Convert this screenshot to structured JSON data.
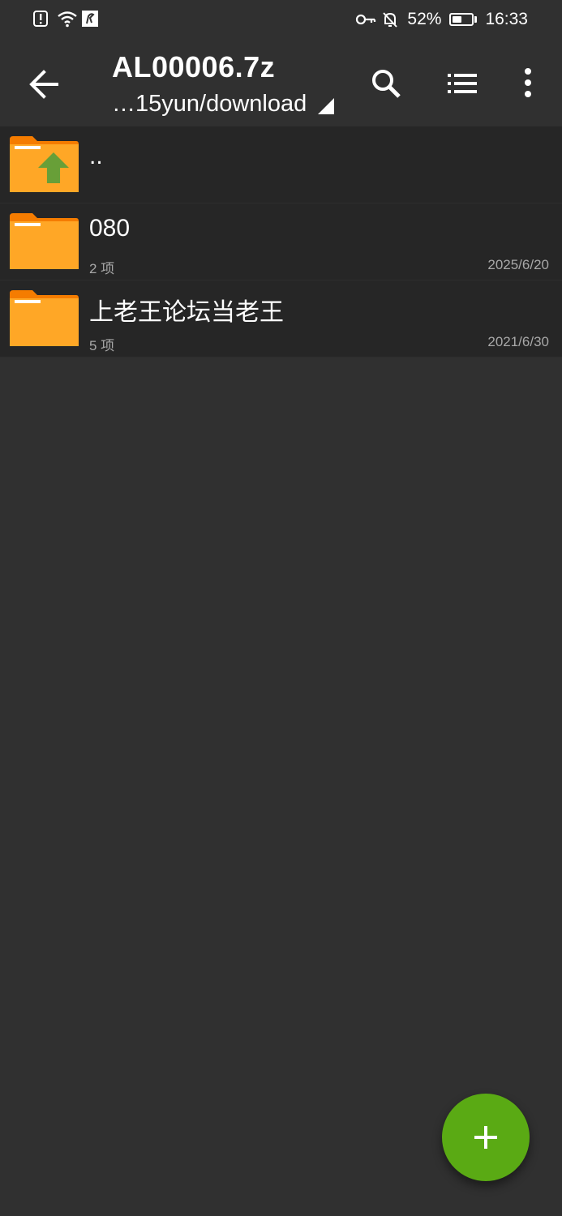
{
  "status_bar": {
    "battery_percent": "52%",
    "battery_level": 0.52,
    "time": "16:33",
    "icons": [
      "alert-sim-icon",
      "wifi-icon",
      "app-notification-icon",
      "key-icon",
      "bell-off-icon",
      "battery-icon"
    ]
  },
  "toolbar": {
    "title": "AL00006.7z",
    "path": "…15yun/download"
  },
  "entries": [
    {
      "name": "..",
      "type": "parent",
      "meta": "",
      "date": ""
    },
    {
      "name": "080",
      "type": "folder",
      "meta": "2 项",
      "date": "2025/6/20"
    },
    {
      "name": "上老王论坛当老王",
      "type": "folder",
      "meta": "5 项",
      "date": "2021/6/30"
    }
  ],
  "colors": {
    "background": "#303030",
    "row_background": "#262626",
    "folder_body": "#ffa726",
    "folder_tab": "#f57c00",
    "arrow": "#689f38",
    "fab": "#5aaa14"
  }
}
